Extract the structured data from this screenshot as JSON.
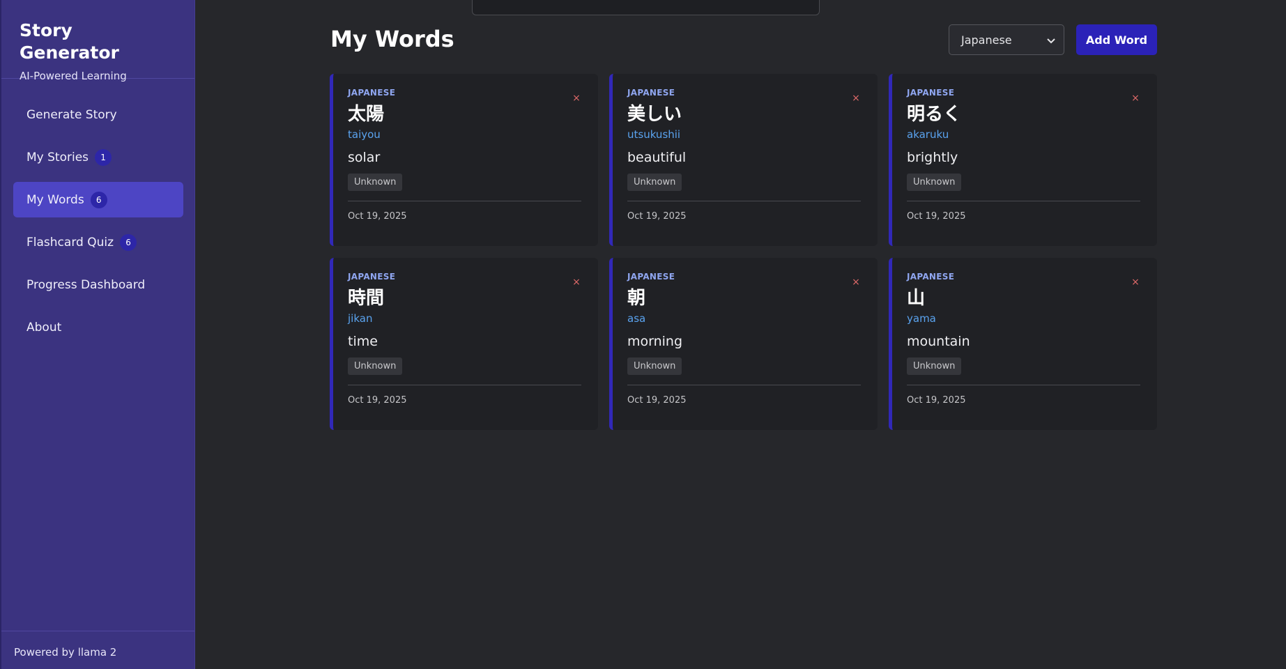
{
  "sidebar": {
    "title": "Story Generator",
    "subtitle": "AI-Powered Learning",
    "nav": [
      {
        "label": "Generate Story",
        "badge": null,
        "active": false
      },
      {
        "label": "My Stories",
        "badge": "1",
        "active": false
      },
      {
        "label": "My Words",
        "badge": "6",
        "active": true
      },
      {
        "label": "Flashcard Quiz",
        "badge": "6",
        "active": false
      },
      {
        "label": "Progress Dashboard",
        "badge": null,
        "active": false
      },
      {
        "label": "About",
        "badge": null,
        "active": false
      }
    ],
    "footer": "Powered by llama 2"
  },
  "header": {
    "title": "My Words",
    "language_select": {
      "value": "Japanese",
      "icon": "chevron-down-icon"
    },
    "add_button": "Add Word"
  },
  "words": [
    {
      "language": "JAPANESE",
      "word": "太陽",
      "reading": "taiyou",
      "meaning": "solar",
      "status": "Unknown",
      "date": "Oct 19, 2025",
      "close_icon": "×"
    },
    {
      "language": "JAPANESE",
      "word": "美しい",
      "reading": "utsukushii",
      "meaning": "beautiful",
      "status": "Unknown",
      "date": "Oct 19, 2025",
      "close_icon": "×"
    },
    {
      "language": "JAPANESE",
      "word": "明るく",
      "reading": "akaruku",
      "meaning": "brightly",
      "status": "Unknown",
      "date": "Oct 19, 2025",
      "close_icon": "×"
    },
    {
      "language": "JAPANESE",
      "word": "時間",
      "reading": "jikan",
      "meaning": "time",
      "status": "Unknown",
      "date": "Oct 19, 2025",
      "close_icon": "×"
    },
    {
      "language": "JAPANESE",
      "word": "朝",
      "reading": "asa",
      "meaning": "morning",
      "status": "Unknown",
      "date": "Oct 19, 2025",
      "close_icon": "×"
    },
    {
      "language": "JAPANESE",
      "word": "山",
      "reading": "yama",
      "meaning": "mountain",
      "status": "Unknown",
      "date": "Oct 19, 2025",
      "close_icon": "×"
    }
  ],
  "colors": {
    "sidebar_bg": "#3b3380",
    "active_nav": "#4d45c4",
    "accent": "#2b22b8",
    "reading_text": "#5aa3ef",
    "delete_icon": "#e06a6a"
  }
}
